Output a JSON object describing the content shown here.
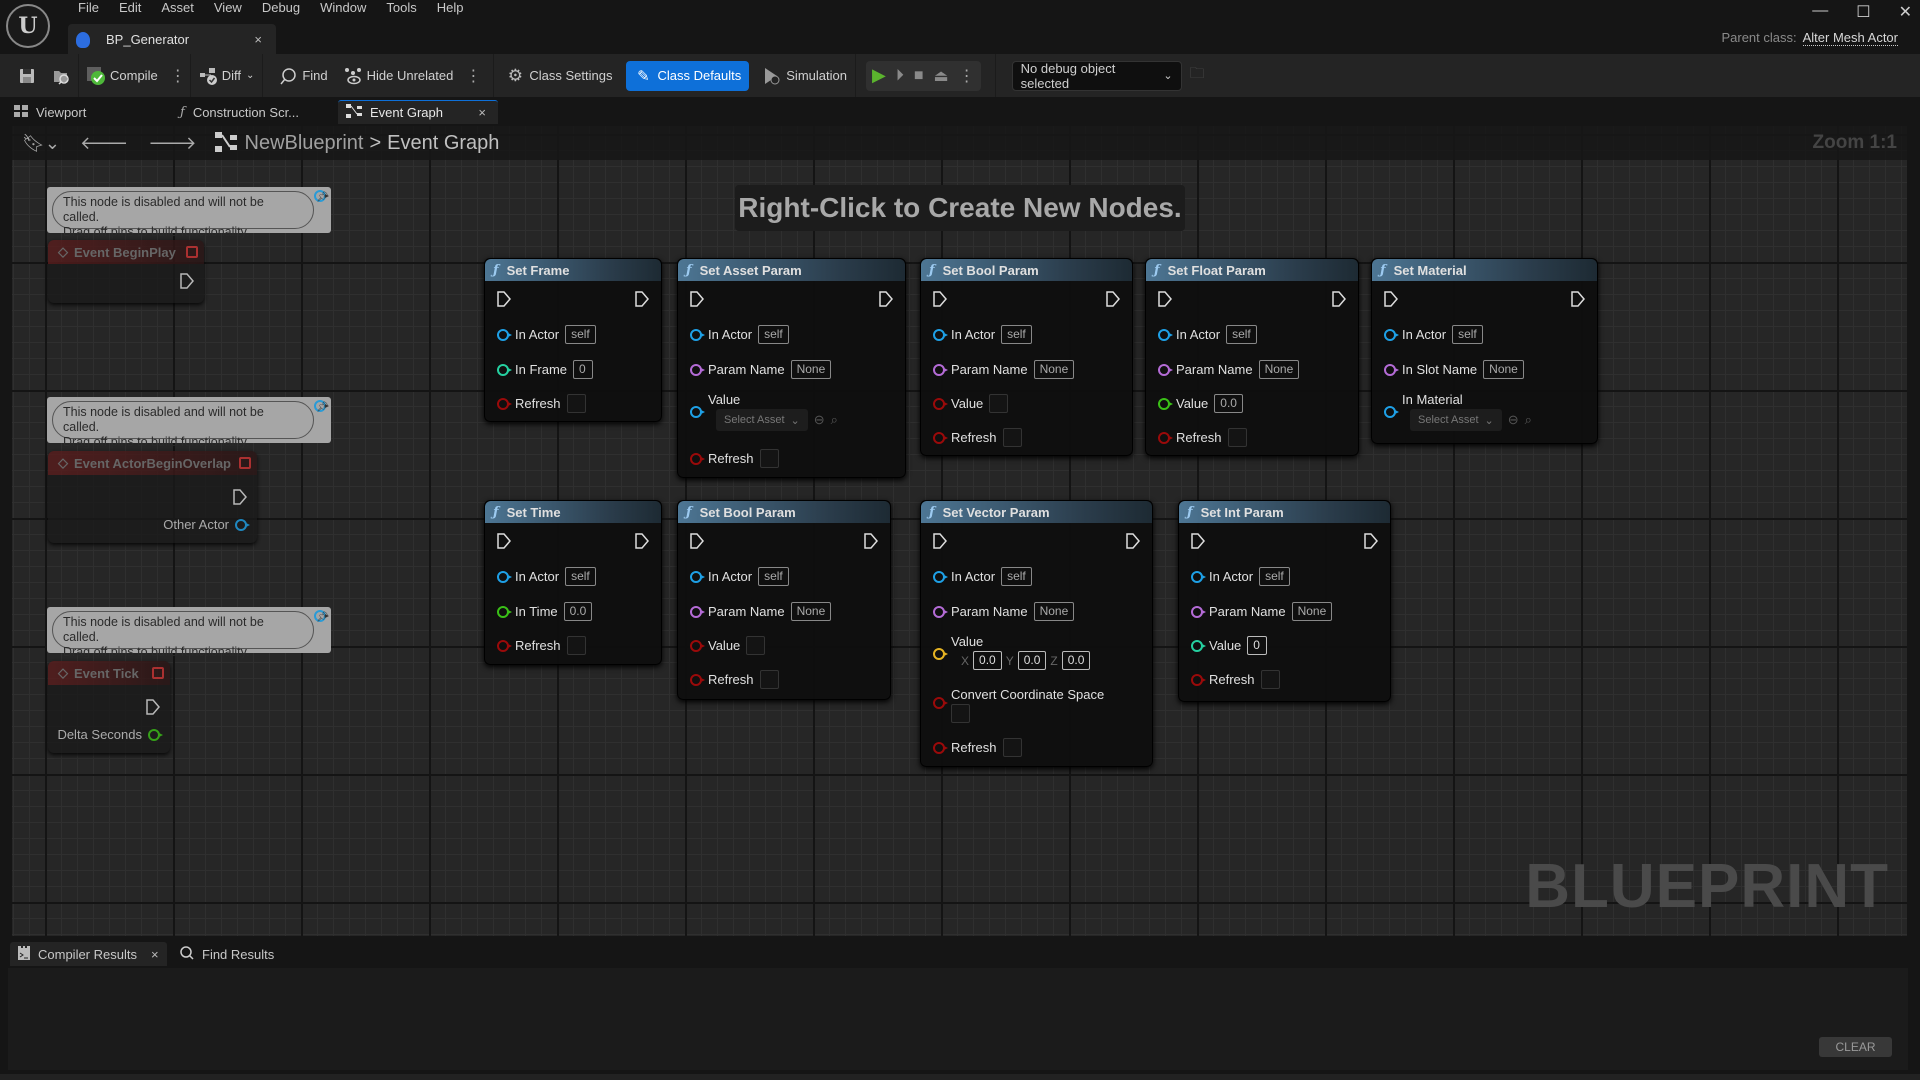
{
  "menu": [
    "File",
    "Edit",
    "Asset",
    "View",
    "Debug",
    "Window",
    "Tools",
    "Help"
  ],
  "document_tab": {
    "label": "BP_Generator",
    "close": "×"
  },
  "window_controls": {
    "minimize": "—",
    "maximize": "☐",
    "close": "✕"
  },
  "parent_class": {
    "label": "Parent class:",
    "value": "Alter Mesh Actor"
  },
  "toolbar": {
    "save_icon": "save-icon",
    "browse_icon": "browse-icon",
    "compile_label": "Compile",
    "diff_label": "Diff",
    "find_label": "Find",
    "hide_unrelated_label": "Hide Unrelated",
    "class_settings_label": "Class Settings",
    "class_defaults_label": "Class Defaults",
    "simulation_label": "Simulation",
    "debug_object": "No debug object selected",
    "accent_color": "#0e70d9"
  },
  "panel_tabs": [
    {
      "label": "Viewport",
      "icon": "viewport-icon"
    },
    {
      "label": "Construction Scr...",
      "icon": "function-icon"
    },
    {
      "label": "Event Graph",
      "icon": "graph-icon",
      "active": true
    }
  ],
  "breadcrumb": {
    "root": "NewBlueprint",
    "separator": ">",
    "current": "Event Graph"
  },
  "zoom_label": "Zoom 1:1",
  "graph_hint": "Right-Click to Create New Nodes.",
  "watermark": "BLUEPRINT",
  "disabled_comment": {
    "line1": "This node is disabled and will not be called.",
    "line2": "Drag off pins to build functionality."
  },
  "event_nodes": [
    {
      "title": "Event BeginPlay",
      "outputs": []
    },
    {
      "title": "Event ActorBeginOverlap",
      "outputs": [
        "Other Actor"
      ]
    },
    {
      "title": "Event Tick",
      "outputs": [
        "Delta Seconds"
      ]
    }
  ],
  "function_nodes": {
    "set_frame": {
      "title": "Set Frame",
      "pins": [
        {
          "label": "In Actor",
          "value": "self"
        },
        {
          "label": "In Frame",
          "value": "0"
        },
        {
          "label": "Refresh"
        }
      ]
    },
    "set_asset_param": {
      "title": "Set Asset Param",
      "pins": [
        {
          "label": "In Actor",
          "value": "self"
        },
        {
          "label": "Param Name",
          "value": "None"
        },
        {
          "label": "Value",
          "value": "Select Asset"
        },
        {
          "label": "Refresh"
        }
      ]
    },
    "set_bool_param": {
      "title": "Set Bool Param",
      "pins": [
        {
          "label": "In Actor",
          "value": "self"
        },
        {
          "label": "Param Name",
          "value": "None"
        },
        {
          "label": "Value"
        },
        {
          "label": "Refresh"
        }
      ]
    },
    "set_float_param": {
      "title": "Set Float Param",
      "pins": [
        {
          "label": "In Actor",
          "value": "self"
        },
        {
          "label": "Param Name",
          "value": "None"
        },
        {
          "label": "Value",
          "value": "0.0"
        },
        {
          "label": "Refresh"
        }
      ]
    },
    "set_material": {
      "title": "Set Material",
      "pins": [
        {
          "label": "In Actor",
          "value": "self"
        },
        {
          "label": "In Slot Name",
          "value": "None"
        },
        {
          "label": "In Material",
          "value": "Select Asset"
        }
      ]
    },
    "set_time": {
      "title": "Set Time",
      "pins": [
        {
          "label": "In Actor",
          "value": "self"
        },
        {
          "label": "In Time",
          "value": "0.0"
        },
        {
          "label": "Refresh"
        }
      ]
    },
    "set_bool_param_2": {
      "title": "Set Bool Param",
      "pins": [
        {
          "label": "In Actor",
          "value": "self"
        },
        {
          "label": "Param Name",
          "value": "None"
        },
        {
          "label": "Value"
        },
        {
          "label": "Refresh"
        }
      ]
    },
    "set_vector_param": {
      "title": "Set Vector Param",
      "pins": [
        {
          "label": "In Actor",
          "value": "self"
        },
        {
          "label": "Param Name",
          "value": "None"
        },
        {
          "label": "Value",
          "x": "0.0",
          "y": "0.0",
          "z": "0.0",
          "xl": "X",
          "yl": "Y",
          "zl": "Z"
        },
        {
          "label": "Convert Coordinate Space"
        },
        {
          "label": "Refresh"
        }
      ]
    },
    "set_int_param": {
      "title": "Set Int Param",
      "pins": [
        {
          "label": "In Actor",
          "value": "self"
        },
        {
          "label": "Param Name",
          "value": "None"
        },
        {
          "label": "Value",
          "value": "0"
        },
        {
          "label": "Refresh"
        }
      ]
    }
  },
  "bottom_tabs": [
    {
      "label": "Compiler Results",
      "close": "×"
    },
    {
      "label": "Find Results"
    }
  ],
  "clear_label": "CLEAR"
}
